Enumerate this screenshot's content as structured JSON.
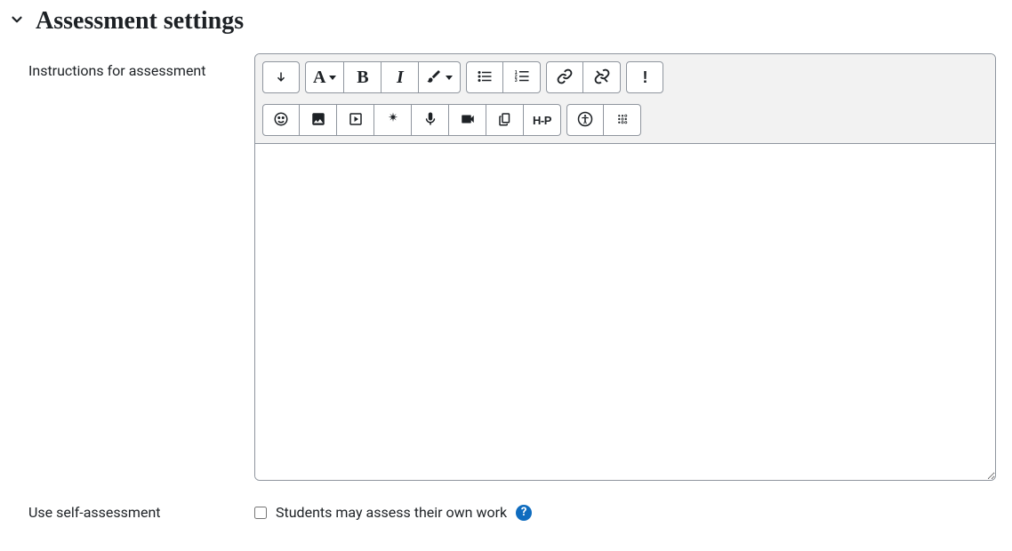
{
  "section": {
    "title": "Assessment settings"
  },
  "fields": {
    "instructions": {
      "label": "Instructions for assessment"
    },
    "self_assessment": {
      "label": "Use self-assessment",
      "checkbox_text": "Students may assess their own work",
      "help": "?"
    }
  },
  "toolbar": {
    "font_letter": "A",
    "bold_letter": "B",
    "italic_letter": "I",
    "exclaim": "!",
    "h5p": "H-P"
  }
}
